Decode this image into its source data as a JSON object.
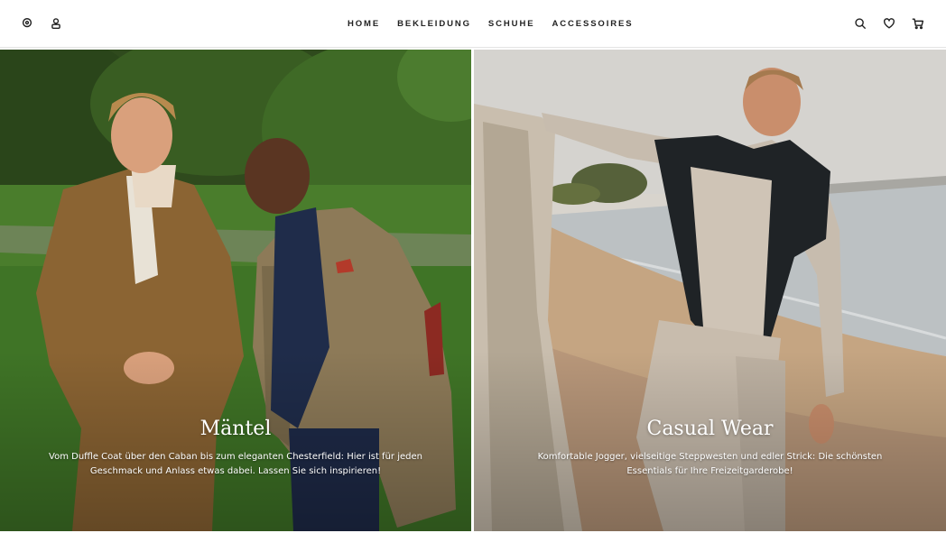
{
  "header": {
    "icons": {
      "store_locator": "location-pin-icon",
      "account": "user-icon",
      "search": "search-icon",
      "wishlist": "heart-icon",
      "cart": "cart-icon"
    },
    "nav": [
      {
        "label": "HOME"
      },
      {
        "label": "BEKLEIDUNG"
      },
      {
        "label": "SCHUHE"
      },
      {
        "label": "ACCESSOIRES"
      }
    ]
  },
  "hero": {
    "left": {
      "title": "Mäntel",
      "text": "Vom Duffle Coat über den Caban bis zum eleganten Chesterfield: Hier ist für jeden Geschmack und Anlass etwas dabei. Lassen Sie sich inspirieren!"
    },
    "right": {
      "title": "Casual Wear",
      "text": "Komfortable Jogger, vielseitige Steppwesten und edler Strick: Die schönsten Essentials für Ihre Freizeitgarderobe!"
    }
  },
  "colors": {
    "accent_text": "#222222",
    "overlay_text": "#ffffff",
    "park_green": "#3f6a2c",
    "beach_sand": "#c9ab88"
  }
}
